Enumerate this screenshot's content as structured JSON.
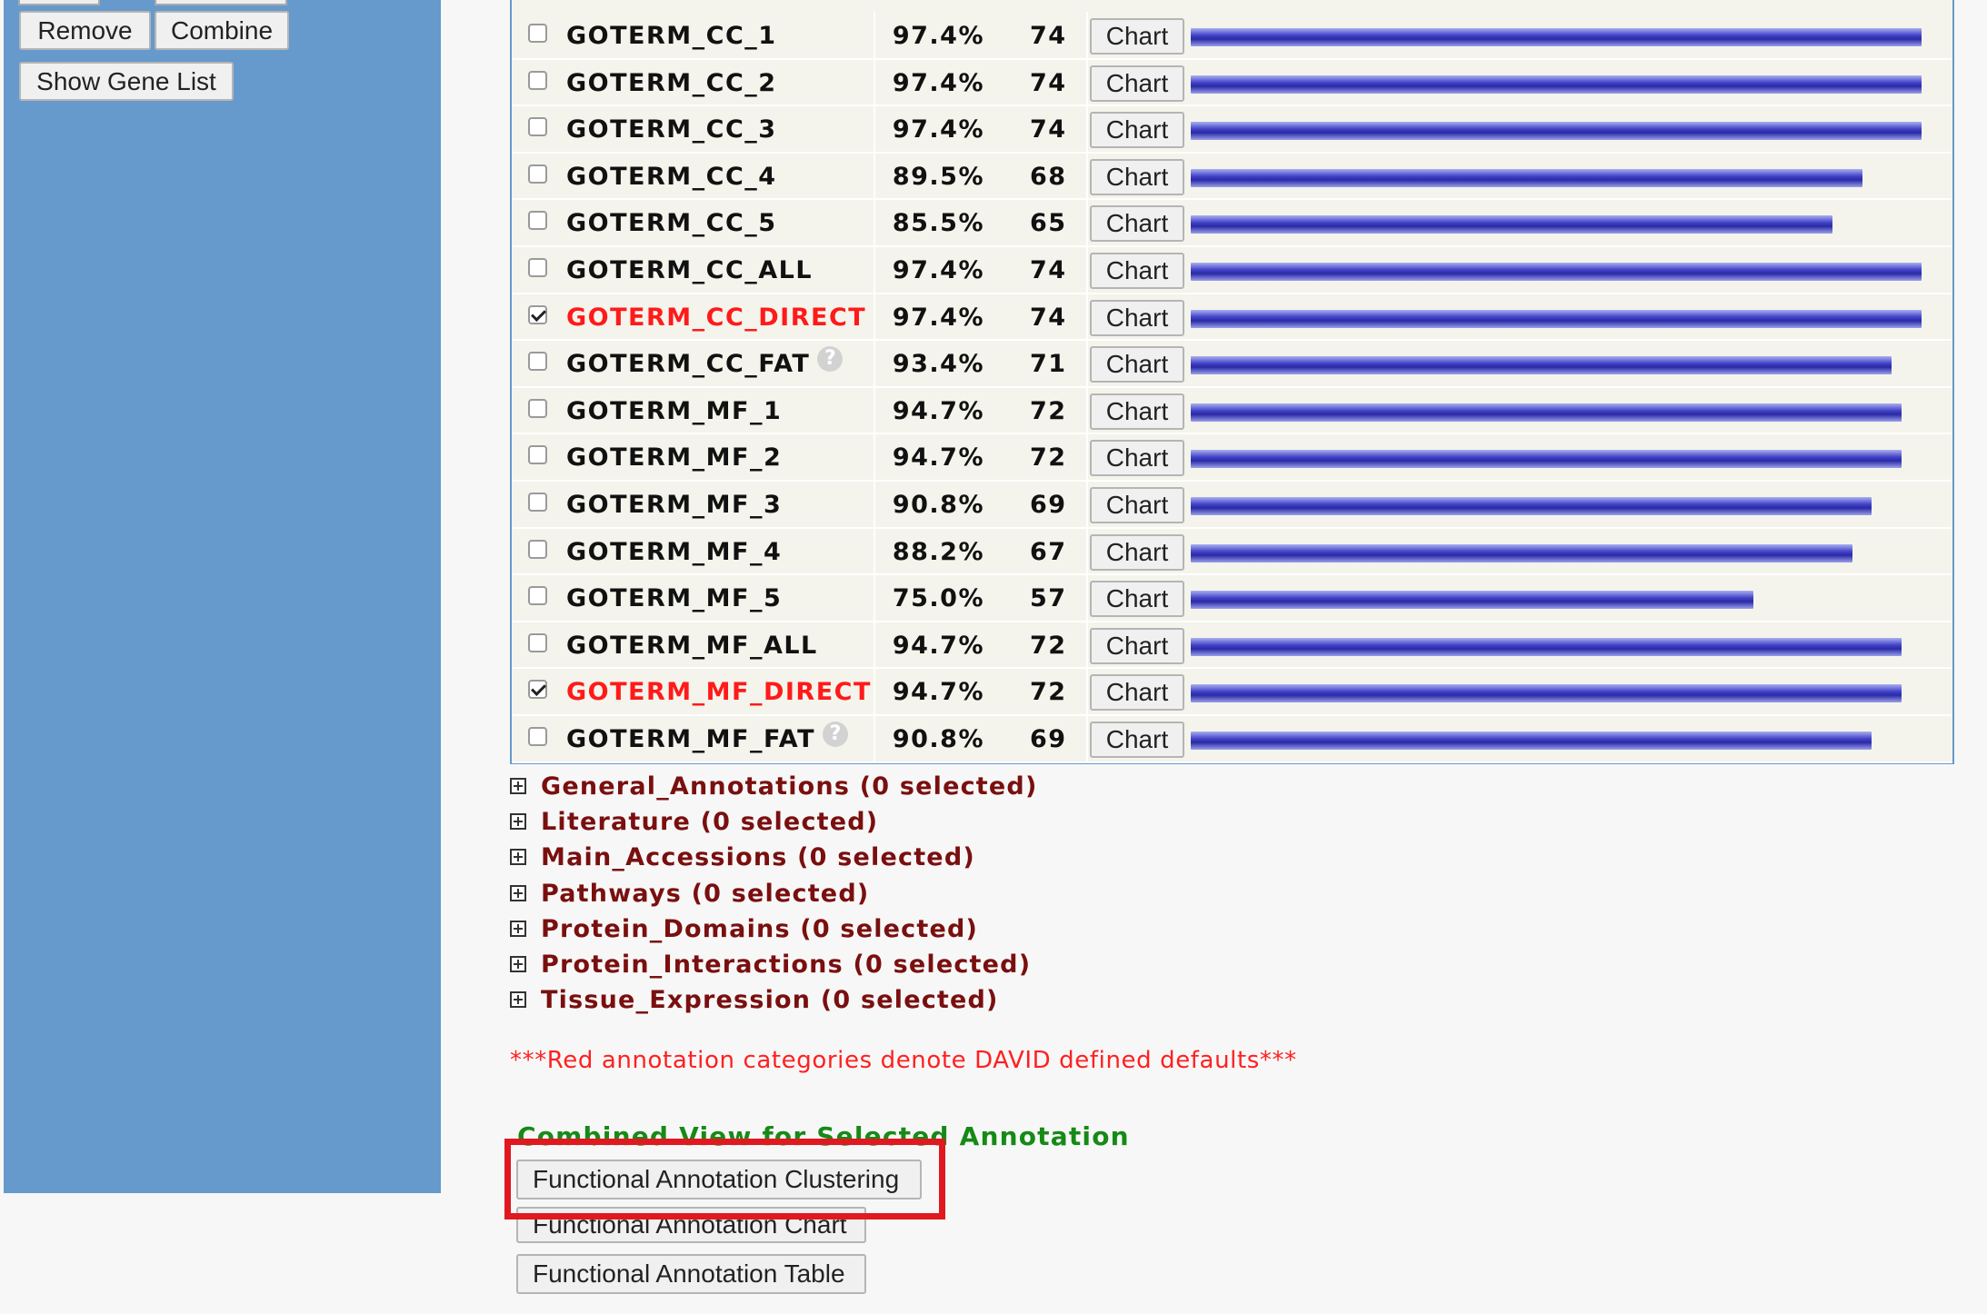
{
  "left_panel": {
    "remove_label": "Remove",
    "combine_label": "Combine",
    "show_gene_list_label": "Show Gene List"
  },
  "annotation_rows": [
    {
      "name": "GOTERM_CC_1",
      "percent": "97.4%",
      "count": "74",
      "chart_label": "Chart",
      "checked": false,
      "default": false,
      "help": false,
      "bar_fraction": 1.0
    },
    {
      "name": "GOTERM_CC_2",
      "percent": "97.4%",
      "count": "74",
      "chart_label": "Chart",
      "checked": false,
      "default": false,
      "help": false,
      "bar_fraction": 1.0
    },
    {
      "name": "GOTERM_CC_3",
      "percent": "97.4%",
      "count": "74",
      "chart_label": "Chart",
      "checked": false,
      "default": false,
      "help": false,
      "bar_fraction": 1.0
    },
    {
      "name": "GOTERM_CC_4",
      "percent": "89.5%",
      "count": "68",
      "chart_label": "Chart",
      "checked": false,
      "default": false,
      "help": false,
      "bar_fraction": 0.919
    },
    {
      "name": "GOTERM_CC_5",
      "percent": "85.5%",
      "count": "65",
      "chart_label": "Chart",
      "checked": false,
      "default": false,
      "help": false,
      "bar_fraction": 0.878
    },
    {
      "name": "GOTERM_CC_ALL",
      "percent": "97.4%",
      "count": "74",
      "chart_label": "Chart",
      "checked": false,
      "default": false,
      "help": false,
      "bar_fraction": 1.0
    },
    {
      "name": "GOTERM_CC_DIRECT",
      "percent": "97.4%",
      "count": "74",
      "chart_label": "Chart",
      "checked": true,
      "default": true,
      "help": false,
      "bar_fraction": 1.0
    },
    {
      "name": "GOTERM_CC_FAT",
      "percent": "93.4%",
      "count": "71",
      "chart_label": "Chart",
      "checked": false,
      "default": false,
      "help": true,
      "bar_fraction": 0.959
    },
    {
      "name": "GOTERM_MF_1",
      "percent": "94.7%",
      "count": "72",
      "chart_label": "Chart",
      "checked": false,
      "default": false,
      "help": false,
      "bar_fraction": 0.973
    },
    {
      "name": "GOTERM_MF_2",
      "percent": "94.7%",
      "count": "72",
      "chart_label": "Chart",
      "checked": false,
      "default": false,
      "help": false,
      "bar_fraction": 0.973
    },
    {
      "name": "GOTERM_MF_3",
      "percent": "90.8%",
      "count": "69",
      "chart_label": "Chart",
      "checked": false,
      "default": false,
      "help": false,
      "bar_fraction": 0.932
    },
    {
      "name": "GOTERM_MF_4",
      "percent": "88.2%",
      "count": "67",
      "chart_label": "Chart",
      "checked": false,
      "default": false,
      "help": false,
      "bar_fraction": 0.905
    },
    {
      "name": "GOTERM_MF_5",
      "percent": "75.0%",
      "count": "57",
      "chart_label": "Chart",
      "checked": false,
      "default": false,
      "help": false,
      "bar_fraction": 0.77
    },
    {
      "name": "GOTERM_MF_ALL",
      "percent": "94.7%",
      "count": "72",
      "chart_label": "Chart",
      "checked": false,
      "default": false,
      "help": false,
      "bar_fraction": 0.973
    },
    {
      "name": "GOTERM_MF_DIRECT",
      "percent": "94.7%",
      "count": "72",
      "chart_label": "Chart",
      "checked": true,
      "default": true,
      "help": false,
      "bar_fraction": 0.973
    },
    {
      "name": "GOTERM_MF_FAT",
      "percent": "90.8%",
      "count": "69",
      "chart_label": "Chart",
      "checked": false,
      "default": false,
      "help": true,
      "bar_fraction": 0.932
    }
  ],
  "groups": [
    {
      "label": "General_Annotations (0 selected)"
    },
    {
      "label": "Literature (0 selected)"
    },
    {
      "label": "Main_Accessions (0 selected)"
    },
    {
      "label": "Pathways (0 selected)"
    },
    {
      "label": "Protein_Domains (0 selected)"
    },
    {
      "label": "Protein_Interactions (0 selected)"
    },
    {
      "label": "Tissue_Expression (0 selected)"
    }
  ],
  "default_note": "***Red annotation categories denote DAVID defined defaults***",
  "combined_view": {
    "heading": "Combined View for Selected Annotation",
    "clustering_label": "Functional Annotation Clustering",
    "chart_label": "Functional Annotation Chart",
    "table_label": "Functional Annotation Table"
  },
  "colors": {
    "panel_blue": "#6699cc",
    "default_red": "#ff1a1a",
    "group_maroon": "#7a0f0f",
    "heading_green": "#168a16",
    "highlight_red": "#e0181f"
  }
}
